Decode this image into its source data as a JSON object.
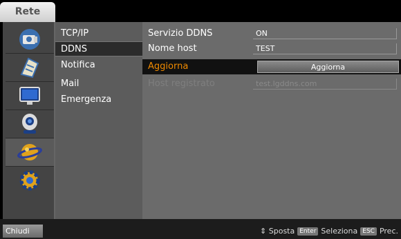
{
  "header": {
    "title": "Rete"
  },
  "icons": [
    "camera-icon",
    "document-icon",
    "monitor-icon",
    "webcam-icon",
    "globe-icon",
    "gear-icon"
  ],
  "menu": {
    "items": [
      "TCP/IP",
      "DDNS",
      "Notifica",
      "Mail",
      "Emergenza"
    ],
    "selected": "DDNS"
  },
  "settings": {
    "ddns_service_label": "Servizio DDNS",
    "ddns_service_value": "ON",
    "hostname_label": "Nome host",
    "hostname_value": "TEST",
    "update_label": "Aggiorna",
    "update_button": "Aggiorna",
    "registered_host_label": "Host registrato",
    "registered_host_value": "test.lgddns.com"
  },
  "footer": {
    "close_label": "Chiudi",
    "hint_move": "⇕ Sposta",
    "key_enter": "Enter",
    "hint_select": "Seleziona",
    "key_esc": "ESC",
    "hint_prev": "Prec."
  },
  "colors": {
    "highlight": "#f08a00",
    "selected_bg": "#2b2b2b"
  }
}
